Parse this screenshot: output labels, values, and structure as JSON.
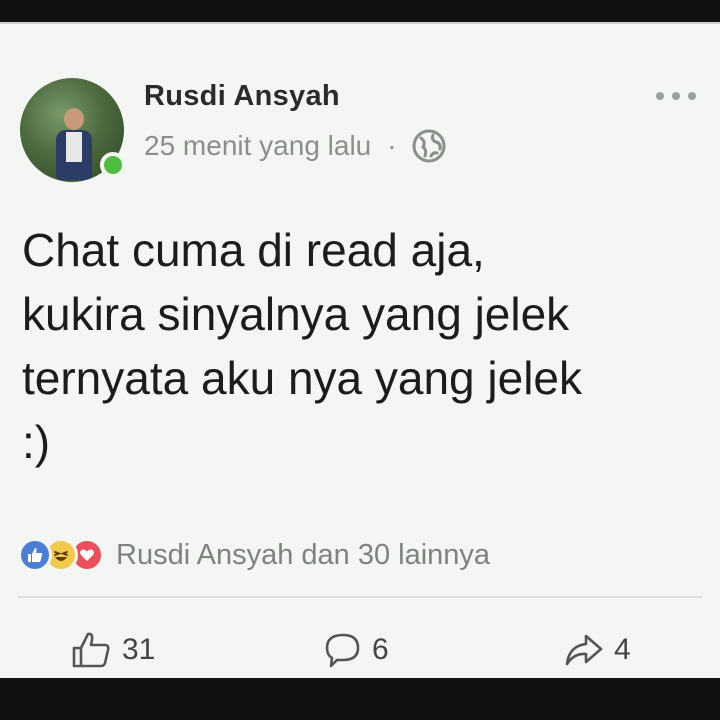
{
  "post": {
    "author": "Rusdi Ansyah",
    "time": "25 menit yang lalu",
    "separator": "·",
    "lines": [
      "Chat cuma di read aja,",
      "kukira sinyalnya yang jelek",
      "ternyata aku nya yang jelek",
      ":)"
    ]
  },
  "reactions": {
    "summary": "Rusdi Ansyah dan 30 lainnya",
    "icons": [
      "like-icon",
      "haha-icon",
      "love-icon"
    ]
  },
  "actions": {
    "like_count": "31",
    "comment_count": "6",
    "share_count": "4"
  },
  "colors": {
    "online": "#4cbd3c",
    "like": "#4b7fd6",
    "haha": "#f3c94a",
    "love": "#ec4f5c"
  }
}
